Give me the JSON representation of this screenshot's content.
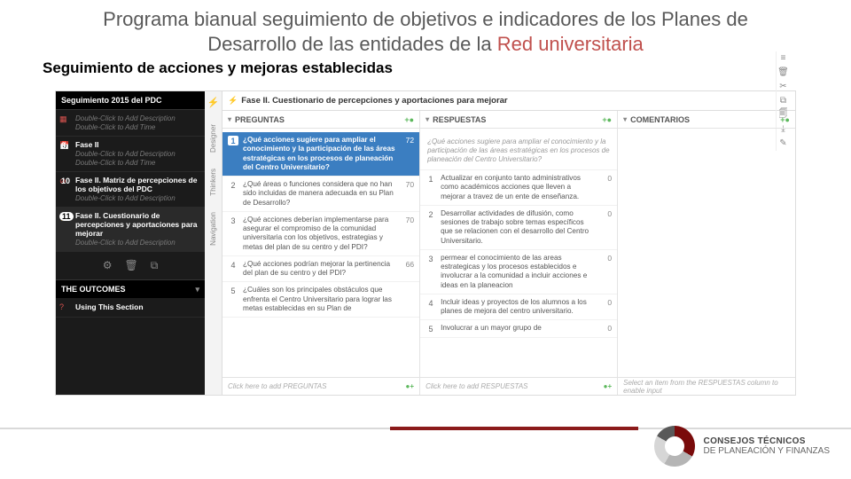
{
  "slide": {
    "title_a": "Programa bianual seguimiento de objetivos e indicadores de los Planes de",
    "title_b": "Desarrollo de las entidades de la ",
    "title_c": "Red universitaria",
    "subtitle": "Seguimiento de acciones y mejoras establecidas"
  },
  "sidebar": {
    "header": "Seguimiento 2015 del PDC",
    "items": [
      {
        "num": "",
        "title": "",
        "hint1": "Double-Click to Add Description",
        "hint2": "Double-Click to Add Time",
        "icon": "grid"
      },
      {
        "num": "9",
        "title": "Fase II",
        "hint1": "Double-Click to Add Description",
        "hint2": "Double-Click to Add Time",
        "icon": "cal"
      },
      {
        "num": "10",
        "title": "Fase II. Matriz de percepciones de los objetivos del PDC",
        "hint1": "Double-Click to Add Description",
        "hint2": "",
        "icon": "check"
      },
      {
        "num": "11",
        "title": "Fase II. Cuestionario de percepciones y aportaciones para mejorar",
        "hint1": "Double-Click to Add Description",
        "hint2": "",
        "icon": "bolt",
        "selected": true
      }
    ],
    "outcomes": "THE OUTCOMES",
    "using": "Using This Section"
  },
  "rail": {
    "bolt": "⚡",
    "tabs": [
      "Designer",
      "Thinkers",
      "Navigation"
    ]
  },
  "topbar": {
    "bolt": "⚡",
    "title": "Fase II. Cuestionario de percepciones y aportaciones para mejorar",
    "icons": [
      "≡",
      "🗑",
      "✂",
      "⧉",
      "🗐",
      "⤓",
      "✎"
    ]
  },
  "columns": {
    "preguntas": {
      "header": "PREGUNTAS",
      "rows": [
        {
          "n": "1",
          "txt": "¿Qué acciones sugiere para ampliar el conocimiento y la participación de las áreas estratégicas en los procesos de planeación del Centro Universitario?",
          "score": "72",
          "active": true
        },
        {
          "n": "2",
          "txt": "¿Qué áreas o funciones considera que no han sido incluidas de manera adecuada en su Plan de Desarrollo?",
          "score": "70"
        },
        {
          "n": "3",
          "txt": "¿Qué acciones deberían implementarse para asegurar el compromiso de la comunidad universitaria con los objetivos, estrategias y metas del plan de su centro y del PDI?",
          "score": "70"
        },
        {
          "n": "4",
          "txt": "¿Qué acciones podrían mejorar la pertinencia del plan de su centro y del PDI?",
          "score": "66"
        },
        {
          "n": "5",
          "txt": "¿Cuáles son los principales obstáculos que enfrenta el Centro Universitario para lograr las metas establecidas en su Plan de",
          "score": ""
        }
      ],
      "footer": "Click here to add PREGUNTAS"
    },
    "respuestas": {
      "header": "RESPUESTAS",
      "quote": "¿Qué acciones sugiere para ampliar el conocimiento y la participación de las áreas estratégicas en los procesos de planeación del Centro Universitario?",
      "rows": [
        {
          "n": "1",
          "txt": "Actualizar en conjunto tanto administrativos como académicos acciones que lleven a mejorar a travez de un ente de enseñanza.",
          "score": "0"
        },
        {
          "n": "2",
          "txt": "Desarrollar actividades de difusión, como sesiones de trabajo sobre temas específicos que se relacionen con el desarrollo del Centro Universitario.",
          "score": "0"
        },
        {
          "n": "3",
          "txt": "permear el conocimiento de las areas estrategicas y los procesos establecidos e involucrar a la comunidad a incluir acciones e ideas en la planeacion",
          "score": "0"
        },
        {
          "n": "4",
          "txt": "Incluir ideas y proyectos de los alumnos a los planes de mejora del centro universitario.",
          "score": "0"
        },
        {
          "n": "5",
          "txt": "Involucrar a un mayor grupo de",
          "score": "0"
        }
      ],
      "footer": "Click here to add RESPUESTAS"
    },
    "comentarios": {
      "header": "COMENTARIOS",
      "footer": "Select an item from the RESPUESTAS column to enable input"
    }
  },
  "brand": {
    "line1": "CONSEJOS TÉCNICOS",
    "line2": "DE PLANEACIÓN Y FINANZAS"
  }
}
